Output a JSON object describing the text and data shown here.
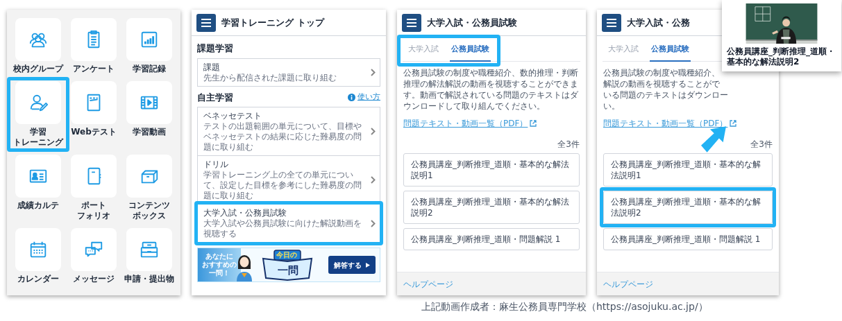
{
  "grid_panel": {
    "tiles": [
      {
        "label_lines": [
          "校内グループ"
        ],
        "highlighted": false
      },
      {
        "label_lines": [
          "アンケート"
        ],
        "highlighted": false
      },
      {
        "label_lines": [
          "学習記録"
        ],
        "highlighted": false
      },
      {
        "label_lines": [
          "学習",
          "トレーニング"
        ],
        "highlighted": true
      },
      {
        "label_lines": [
          "Webテスト"
        ],
        "highlighted": false
      },
      {
        "label_lines": [
          "学習動画"
        ],
        "highlighted": false
      },
      {
        "label_lines": [
          "成績カルテ"
        ],
        "highlighted": false
      },
      {
        "label_lines": [
          "ポート",
          "フォリオ"
        ],
        "highlighted": false
      },
      {
        "label_lines": [
          "コンテンツ",
          "ボックス"
        ],
        "highlighted": false
      },
      {
        "label_lines": [
          "カレンダー"
        ],
        "highlighted": false
      },
      {
        "label_lines": [
          "メッセージ"
        ],
        "highlighted": false
      },
      {
        "label_lines": [
          "申請・提出物"
        ],
        "highlighted": false
      }
    ]
  },
  "training_panel": {
    "header": {
      "title": "学習トレーニング トップ"
    },
    "sections": [
      {
        "heading": "課題学習",
        "items": [
          {
            "title": "課題",
            "description": "先生から配信された課題に取り組む",
            "highlighted": false
          }
        ]
      },
      {
        "heading": "自主学習",
        "help_link": "使い方",
        "items": [
          {
            "title": "ベネッセテスト",
            "description": "テストの出題範囲の単元について、目標やベネッセテストの結果に応じた難易度の問題に取り組む",
            "highlighted": false
          },
          {
            "title": "ドリル",
            "description": "学習トレーニング上の全ての単元について、設定した目標を参考にした難易度の問題に取り組む",
            "highlighted": false
          },
          {
            "title": "大学入試・公務員試験",
            "description": "大学入試や公務員試験に向けた解説動画を視聴する",
            "highlighted": true
          }
        ]
      }
    ],
    "banner": {
      "tagline_lines": [
        "あなたに",
        "おすすめの",
        "一問！"
      ],
      "headline_top": "今日の",
      "headline_main": "一問",
      "button": "解答する"
    }
  },
  "exam_panel": {
    "header": {
      "title": "大学入試・公務員試験"
    },
    "tabs_highlighted": true,
    "tabs": [
      {
        "label": "大学入試",
        "selected": false
      },
      {
        "label": "公務員試験",
        "selected": true
      }
    ],
    "description": "公務員試験の制度や職種紹介、数的推理・判断推理の解法解説の動画を視聴することができます。動画で解説されている問題のテキストはダウンロードして取り組んでください。",
    "pdf_link": "問題テキスト・動画一覧（PDF）",
    "count": "全3件",
    "videos": [
      {
        "title": "公務員講座_判断推理_道順・基本的な解法説明1",
        "highlighted": false
      },
      {
        "title": "公務員講座_判断推理_道順・基本的な解法説明2",
        "highlighted": false
      },
      {
        "title": "公務員講座_判断推理_道順・問題解説 1",
        "highlighted": false
      }
    ],
    "footer_link": "ヘルプページ"
  },
  "exam_panel_zoomed": {
    "header": {
      "title": "大学入試・公務"
    },
    "tabs_highlighted": false,
    "tabs": [
      {
        "label": "大学入試",
        "selected": false
      },
      {
        "label": "公務員試験",
        "selected": true
      }
    ],
    "description_lines": [
      "公務員試験の制度や職種紹介、",
      "解説の動画を視聴することがで",
      "いる問題のテキストはダウンロー",
      "い。"
    ],
    "pdf_link": "問題テキスト・動画一覧（PDF）",
    "count": "全3件",
    "videos": [
      {
        "title": "公務員講座_判断推理_道順・基本的な解法説明1",
        "highlighted": false
      },
      {
        "title": "公務員講座_判断推理_道順・基本的な解法説明2",
        "highlighted": true
      },
      {
        "title": "公務員講座_判断推理_道順・問題解説 1",
        "highlighted": false
      }
    ],
    "footer_link": "ヘルプページ",
    "video_popup": {
      "kind": "picture",
      "caption": "公務員講座_判断推理_道順・基本的な解法説明2"
    }
  },
  "credit": "上記動画作成者：麻生公務員専門学校（https://asojuku.ac.jp/）"
}
